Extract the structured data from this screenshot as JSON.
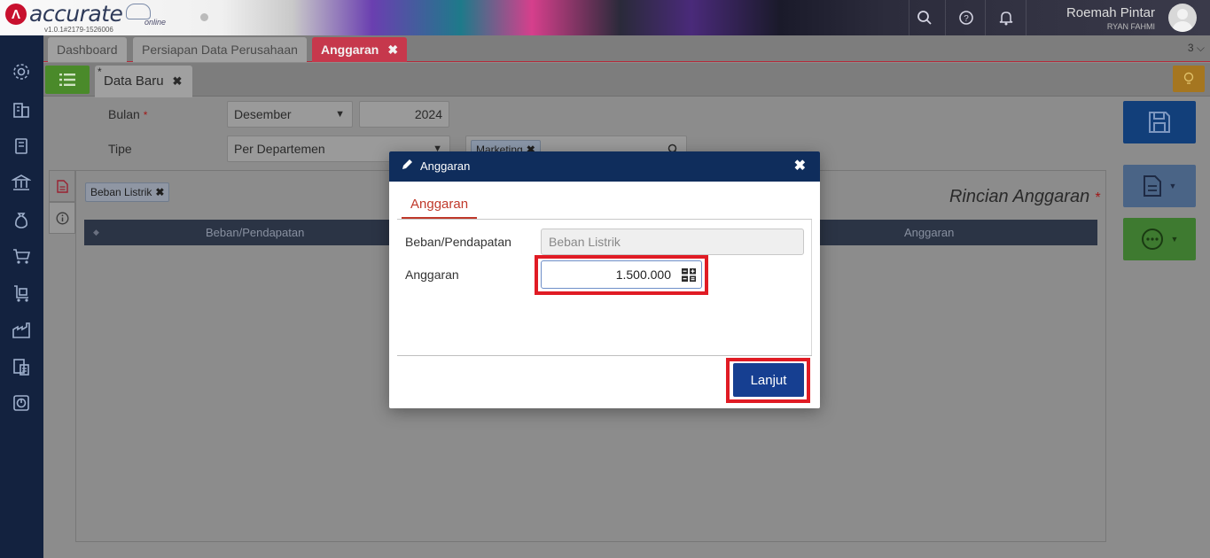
{
  "app": {
    "brand": "accurate",
    "brand_sub": "online",
    "version": "v1.0.1#2179-1526006",
    "user_name": "Roemah Pintar",
    "user_sub": "RYAN FAHMI"
  },
  "tabs": [
    {
      "label": "Dashboard"
    },
    {
      "label": "Persiapan Data Perusahaan"
    },
    {
      "label": "Anggaran",
      "close": "✖"
    }
  ],
  "tab_count": "3 ⌵",
  "subtab": {
    "star": "*",
    "label": "Data Baru",
    "close": "✖"
  },
  "form": {
    "bulan_label": "Bulan",
    "required_mark": "*",
    "bulan_value": "Desember",
    "tahun_value": "2024",
    "tipe_label": "Tipe",
    "tipe_value": "Per Departemen",
    "departemen_chip": "Marketing",
    "chip_close": "✖"
  },
  "panel": {
    "filter_chip": "Beban Listrik",
    "title": "Rincian Anggaran",
    "columns": [
      "Beban/Pendapatan",
      "Anggaran"
    ]
  },
  "modal": {
    "title": "Anggaran",
    "close": "✖",
    "tab": "Anggaran",
    "beban_label": "Beban/Pendapatan",
    "beban_placeholder": "Beban Listrik",
    "anggaran_label": "Anggaran",
    "anggaran_value": "1.500.000",
    "submit": "Lanjut"
  },
  "colors": {
    "accent_red": "#c6384c",
    "highlight": "#e01b24",
    "sidebar": "#13223f",
    "modal_header": "#0f2d5c",
    "primary_button": "#163f91"
  }
}
